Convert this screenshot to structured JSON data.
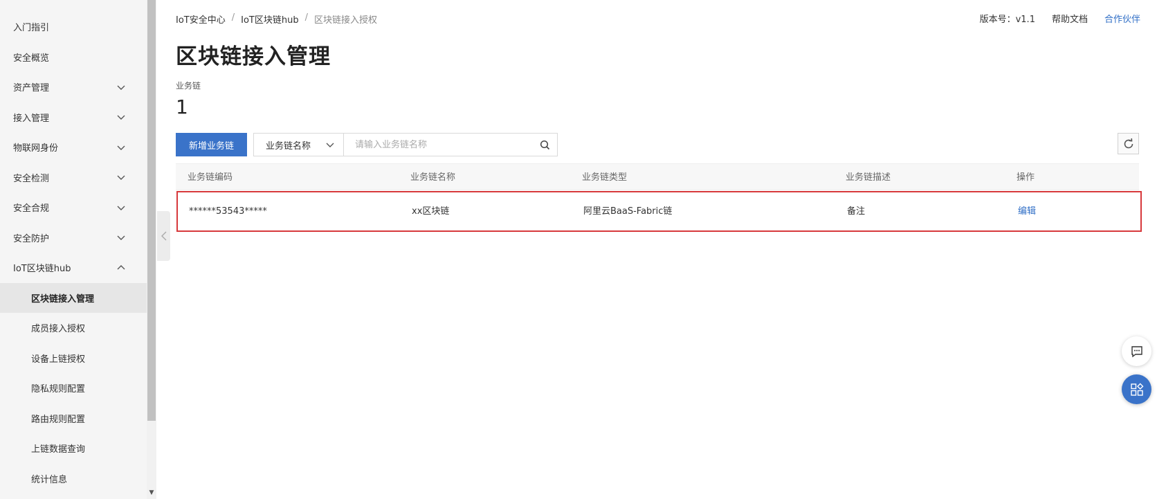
{
  "sidebar": {
    "items": [
      {
        "label": "入门指引",
        "expandable": false
      },
      {
        "label": "安全概览",
        "expandable": false
      },
      {
        "label": "资产管理",
        "expandable": true,
        "expanded": false
      },
      {
        "label": "接入管理",
        "expandable": true,
        "expanded": false
      },
      {
        "label": "物联网身份",
        "expandable": true,
        "expanded": false
      },
      {
        "label": "安全检测",
        "expandable": true,
        "expanded": false
      },
      {
        "label": "安全合规",
        "expandable": true,
        "expanded": false
      },
      {
        "label": "安全防护",
        "expandable": true,
        "expanded": false
      },
      {
        "label": "IoT区块链hub",
        "expandable": true,
        "expanded": true
      }
    ],
    "sub_items": [
      {
        "label": "区块链接入管理",
        "active": true
      },
      {
        "label": "成员接入授权",
        "active": false
      },
      {
        "label": "设备上链授权",
        "active": false
      },
      {
        "label": "隐私规则配置",
        "active": false
      },
      {
        "label": "路由规则配置",
        "active": false
      },
      {
        "label": "上链数据查询",
        "active": false
      },
      {
        "label": "统计信息",
        "active": false
      }
    ]
  },
  "breadcrumb": [
    "IoT安全中心",
    "IoT区块链hub",
    "区块链接入授权"
  ],
  "breadcrumb_separator": "/",
  "header": {
    "version": "版本号：v1.1",
    "help_doc": "帮助文档",
    "partner": "合作伙伴"
  },
  "page": {
    "title": "区块链接入管理",
    "stat_label": "业务链",
    "stat_value": "1"
  },
  "toolbar": {
    "add_button": "新增业务链",
    "search_field_select": "业务链名称",
    "search_placeholder": "请输入业务链名称"
  },
  "table": {
    "columns": [
      "业务链编码",
      "业务链名称",
      "业务链类型",
      "业务链描述",
      "操作"
    ],
    "rows": [
      {
        "code": "******53543*****",
        "name": "xx区块链",
        "type": "阿里云BaaS-Fabric链",
        "desc": "备注",
        "action": "编辑"
      }
    ],
    "highlight_color": "#d7383b"
  },
  "colors": {
    "accent": "#3a73c9",
    "link": "#2f6ec6"
  }
}
